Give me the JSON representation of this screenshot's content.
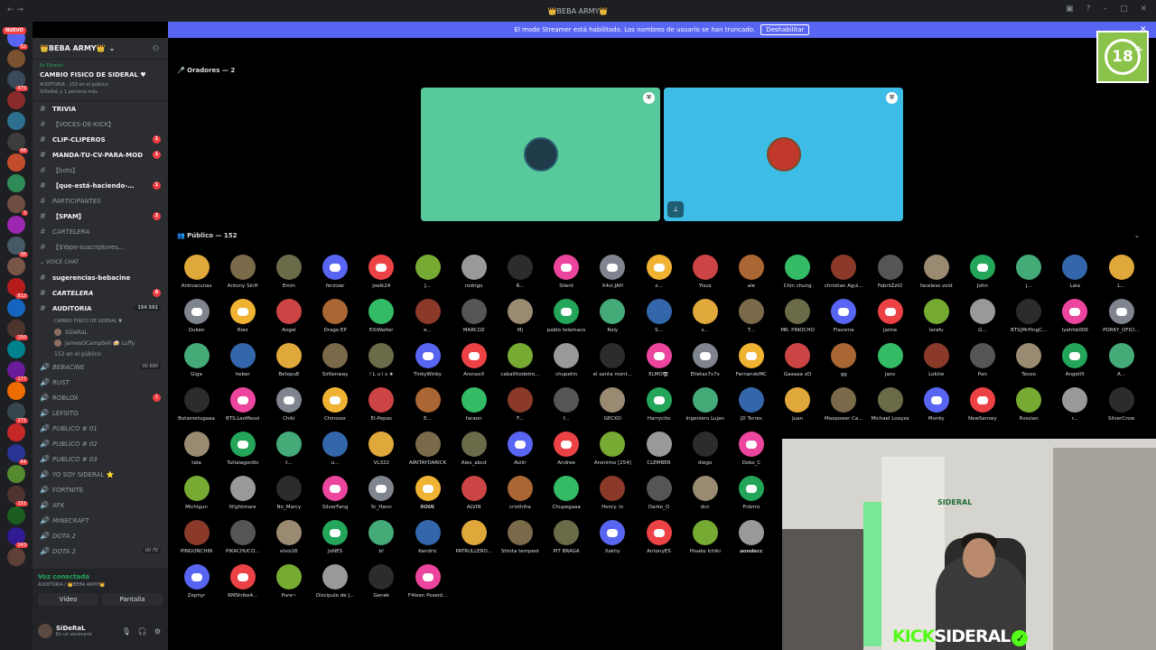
{
  "window": {
    "title": "👑BEBA ARMY👑"
  },
  "banner": {
    "text": "El modo Streamer está habilitado. Los nombres de usuario se han truncado.",
    "button": "Deshabilitar"
  },
  "server_rail": {
    "new_label": "NUEVO",
    "badges": [
      "52",
      "475",
      "48",
      "3",
      "36",
      "812",
      "150",
      "177",
      "171",
      "44",
      "151",
      "143"
    ]
  },
  "server": {
    "name": "👑BEBA ARMY👑"
  },
  "event": {
    "live": "En Directo",
    "title": "CAMBIO FISICO DE SIDERAL ♥",
    "meta": "AUDITORIA · 152 en el público",
    "people": "SiDeRaL y 1 persona más"
  },
  "channels": [
    {
      "label": "TRIVIA",
      "style": "bold"
    },
    {
      "label": "【VOCES-DE-KICK】",
      "style": ""
    },
    {
      "label": "CLIP-CLIPEROS",
      "style": "bold",
      "badge": "1"
    },
    {
      "label": "MANDA-TU-CV-PARA-MOD",
      "style": "bold",
      "badge": "1"
    },
    {
      "label": "【bots】",
      "style": ""
    },
    {
      "label": "【que-está-haciendo-…",
      "style": "bold",
      "badge": "1"
    },
    {
      "label": "PARTICIPANTES",
      "style": "it"
    },
    {
      "label": "【SPAM】",
      "style": "bold",
      "badge": "2"
    },
    {
      "label": "CARTELERA",
      "style": "it"
    },
    {
      "label": "【$Yape-suscriptores…",
      "style": ""
    }
  ],
  "voice_category": "VOICE CHAT",
  "voice_channels": [
    {
      "label": "sugerencias-bebacine",
      "style": "bold"
    },
    {
      "label": "CARTELERA",
      "style": "bold it",
      "badge": "6"
    },
    {
      "label": "AUDITORIA",
      "style": "bold",
      "count": "154 591"
    }
  ],
  "stage_sub": {
    "name": "CAMBIO FISICO DE SIDERAL ♥",
    "users": [
      "SiDeRaL",
      "JamesOCampbell 🍻 Luffy"
    ],
    "public": "152 en el público"
  },
  "voice_channels2": [
    {
      "label": "BEBACINE",
      "style": "it",
      "count": "00 690"
    },
    {
      "label": "RUST",
      "style": "it"
    },
    {
      "label": "ROBLOX",
      "style": "",
      "badge": "1"
    },
    {
      "label": "LEFSITO",
      "style": ""
    },
    {
      "label": "PUBLICO # 01",
      "style": "it"
    },
    {
      "label": "PUBLICO # 02",
      "style": "it"
    },
    {
      "label": "PUBLICO # 03",
      "style": "it"
    },
    {
      "label": "YO SOY SIDERAL ⭐",
      "style": ""
    },
    {
      "label": "FORTNITE",
      "style": ""
    },
    {
      "label": "AFK",
      "style": ""
    },
    {
      "label": "MINECRAFT",
      "style": "it"
    },
    {
      "label": "DOTA 2",
      "style": "it"
    },
    {
      "label": "DOTA 2",
      "style": "it",
      "count": "00 70"
    }
  ],
  "voice_panel": {
    "status": "Voz conectada",
    "server": "AUDITORIA / 👑BEBA ARMY👑",
    "video": "Vídeo",
    "screen": "Pantalla"
  },
  "user": {
    "name": "SiDeRaL",
    "status": "En un escenario"
  },
  "stage": {
    "speakers": "Oradores — 2",
    "public": "Público — 152"
  },
  "audience": [
    [
      "Antivacunas",
      "Antony SinH",
      "Emin",
      "ferzizer",
      "joelk24",
      "J...",
      "rodrigo",
      "R...",
      "Silent",
      "X4vi.JAH",
      "x...",
      "Yisus",
      "ale",
      "Chin chung",
      "christian Agui...",
      "FabriiZziO",
      "faceless void",
      "John",
      "j...",
      "Lala",
      "L..."
    ],
    [
      "Ouken",
      "Riez",
      "Angel",
      "Drago EP",
      "EXiWalter",
      "e...",
      "MARCOZ",
      "Mj",
      "pablo telemaco",
      "Roly",
      "S...",
      "s...",
      "T...",
      "MR. PINOCHO",
      "Flavsme",
      "Jaime",
      "larafu",
      "G...",
      "BTS|MrPingC...",
      "lyehhb006",
      "PORKY_OFICI..."
    ],
    [
      "Giga",
      "heber",
      "BetopuE",
      "SirKenway",
      "! L u i s ★",
      "TinkyWinky",
      "AronaxX",
      "caballitodetro...",
      "chupetin",
      "el santa mont...",
      "ELMO👽",
      "Eltetas7v7x",
      "FernandoMC",
      "Gaaaaa xD",
      "gg",
      "Jans",
      "Lokiiw",
      "Pan",
      "Tavoo",
      "AngelIX",
      "A..."
    ],
    [
      "Botametugaaa",
      "BTS.LeoMessi",
      "Chiki",
      "Chinosor",
      "El-Pepas",
      "E...",
      "faraon",
      "F...",
      "f...",
      "GECKO",
      "Harrycito",
      "Ingeniero Lujan",
      "JD Torres",
      "Juan",
      "Maxpower Ca...",
      "Michael Loayza",
      "Monky",
      "NewSensey",
      "Rvssian",
      "r...",
      "SilverCrow"
    ],
    [
      "tala",
      "Tutialagordis",
      "t...",
      "u...",
      "VL322",
      "AIRITAYDARICK",
      "Alex_abcd",
      "Aizlir",
      "Andree",
      "Anónimo [254]",
      "CLEMBER",
      "diego",
      "Doko_C"
    ],
    [
      "Michigun",
      "N!ghtmare",
      "No_Marcy",
      "SilverFang",
      "Sr_Hann",
      "𝙎𝙊𝙐𝙇",
      "ALVIN",
      "cristhiha",
      "Chupegaaa",
      "Henry. tc",
      "Darko_O",
      "dcn",
      "Frdzrro"
    ],
    [
      "PINGONCHIN",
      "PIKACHUCO...",
      "elviz26",
      "JoNES",
      "b!",
      "Kendric",
      "PATRULLERO...",
      "Shinta tempest",
      "PIT BRAGA",
      "Xakhy",
      "AntonyES",
      "Hisako Ichiki",
      "𝙖𝙤𝙣𝙙𝙚𝙘𝙘"
    ],
    [
      "Zephyr",
      "RMStrike4...",
      "Pure~",
      "Discipulo de J...",
      "Genek",
      "F4leen Poseid..."
    ]
  ],
  "overlay": {
    "kick": "KICK",
    "streamer": "SIDERAL",
    "age": "18",
    "webcam_sign": "SIDERAL"
  },
  "colors": {
    "blurple": "#5865f2",
    "kick_green": "#53fc18",
    "tile1": "#57c99a",
    "tile2": "#3dbde6"
  }
}
